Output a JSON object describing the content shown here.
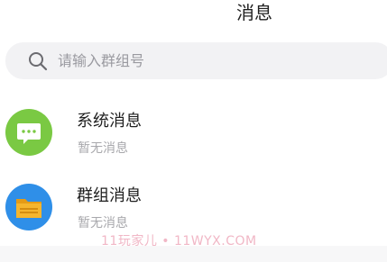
{
  "header": {
    "title": "消息"
  },
  "search": {
    "placeholder": "请输入群组号",
    "icon": "search-icon"
  },
  "conversations": [
    {
      "title": "系统消息",
      "subtitle": "暂无消息",
      "icon": "chat-bubble-icon",
      "color": "#7ac943"
    },
    {
      "title": "群组消息",
      "subtitle": "暂无消息",
      "icon": "folder-icon",
      "color": "#2f8fe8"
    }
  ],
  "watermark": {
    "text": "11玩家儿 • 11WYX.COM"
  },
  "colors": {
    "system_avatar": "#7ac943",
    "group_avatar": "#2f8fe8",
    "folder": "#f5b52e",
    "search_bg": "#f2f2f4"
  }
}
